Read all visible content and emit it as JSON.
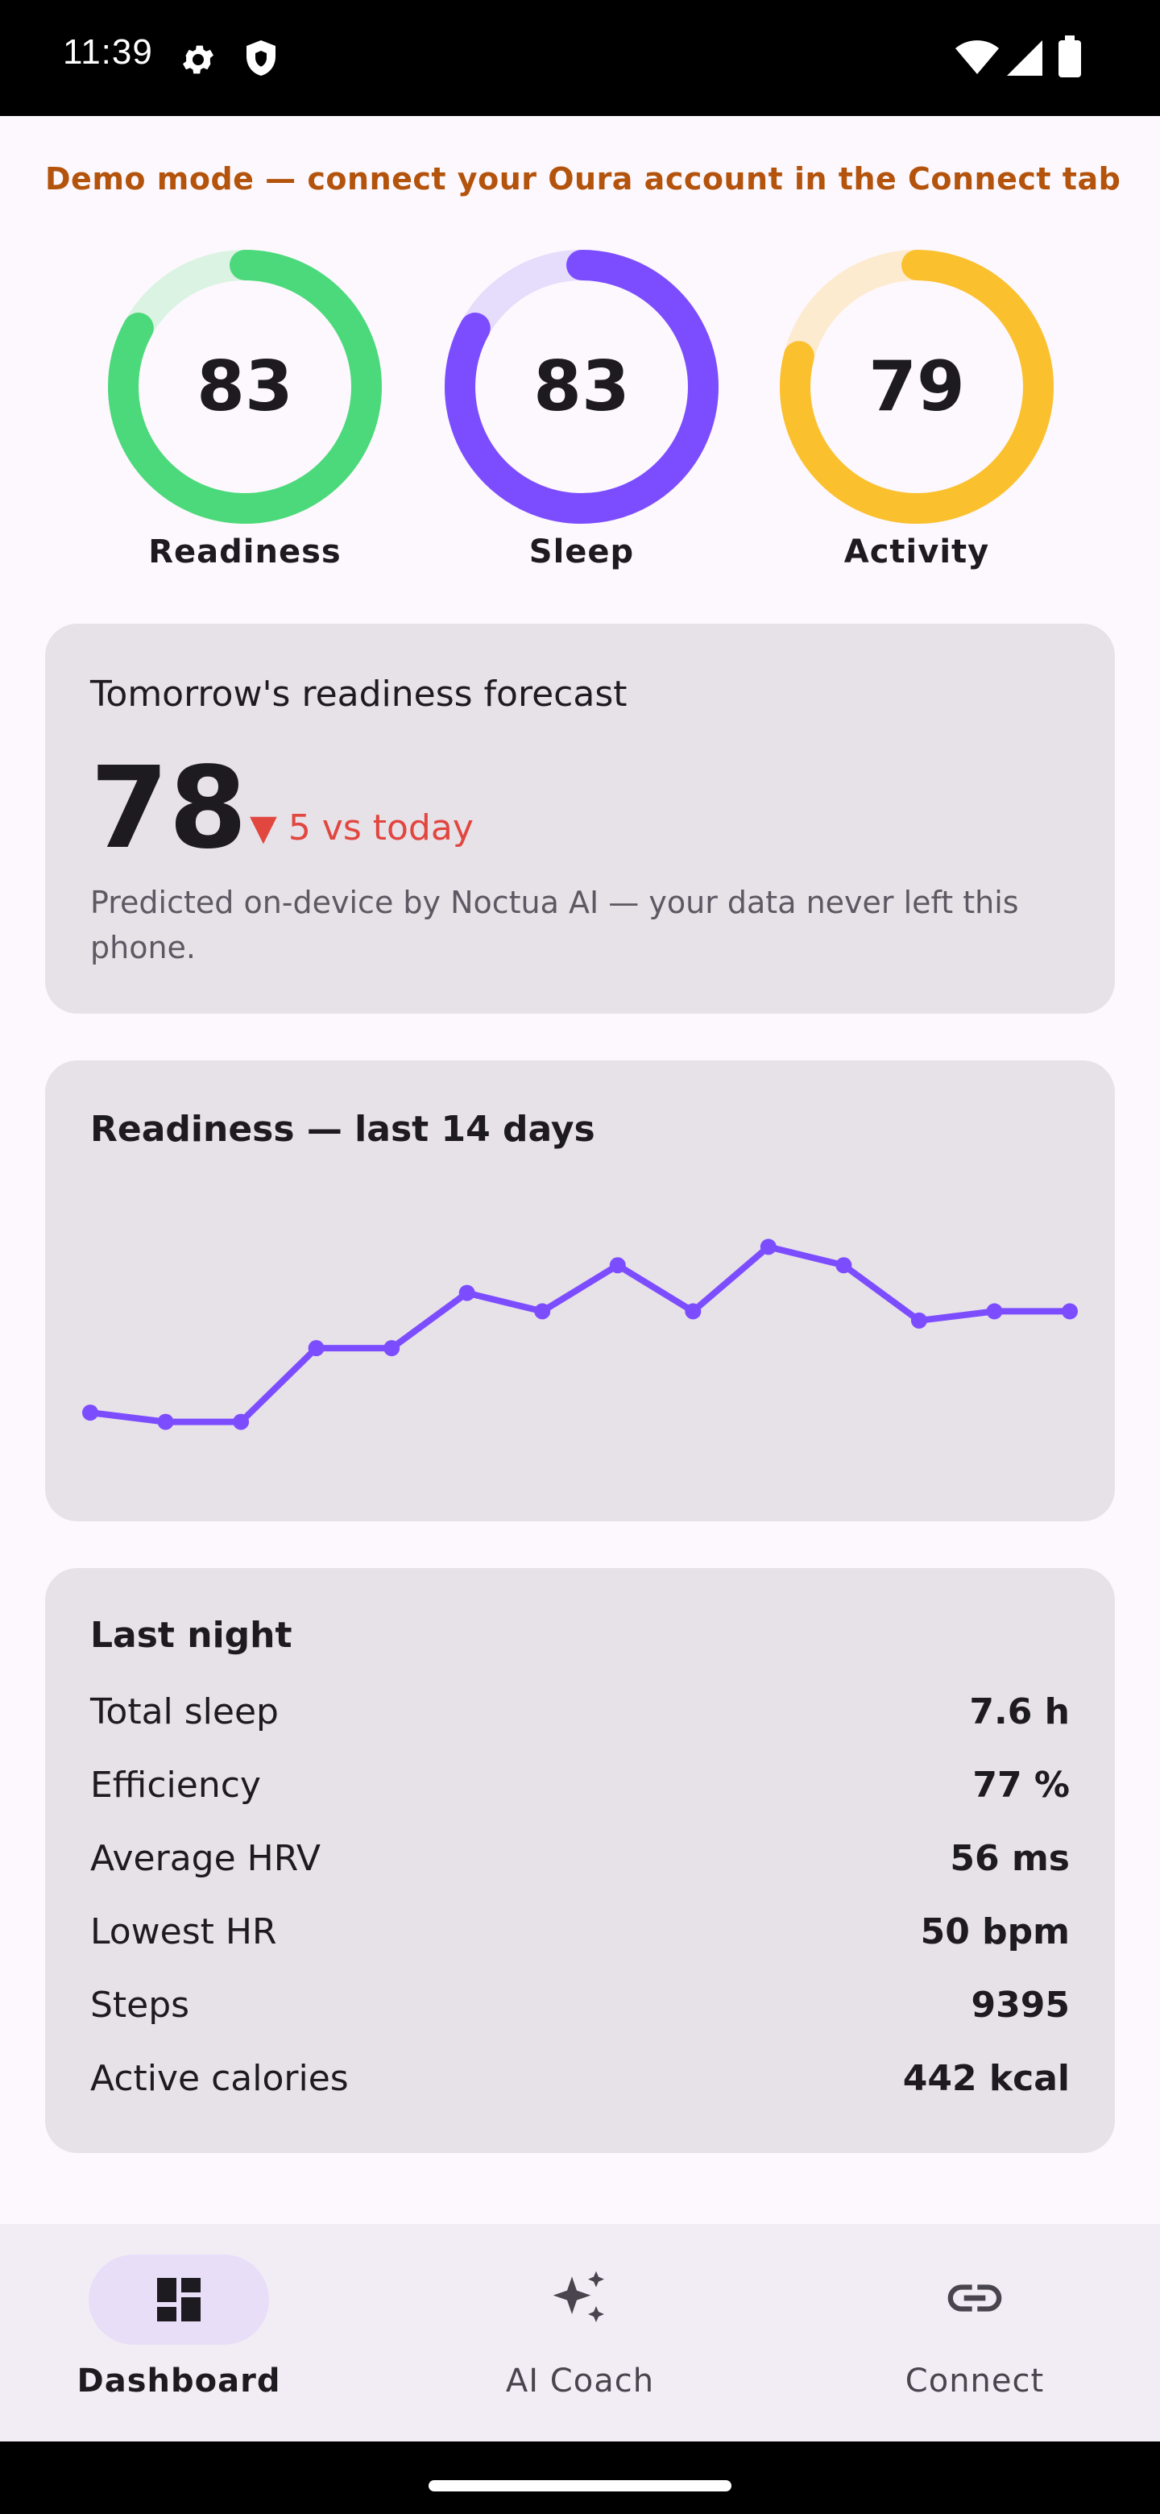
{
  "status_bar": {
    "time": "11:39",
    "icons_left": [
      "gear-icon",
      "shield-icon"
    ],
    "icons_right": [
      "wifi-icon",
      "signal-icon",
      "battery-icon"
    ]
  },
  "banner": {
    "text": "Demo mode — connect your Oura account in the Connect tab",
    "color": "#b3530c"
  },
  "rings": [
    {
      "label": "Readiness",
      "value": "83",
      "score": 83,
      "color": "#4cd97b",
      "track": "#dbf3e2"
    },
    {
      "label": "Sleep",
      "value": "83",
      "score": 83,
      "color": "#7c4dff",
      "track": "#e6dcfb"
    },
    {
      "label": "Activity",
      "value": "79",
      "score": 79,
      "color": "#fbc02d",
      "track": "#fdebd0"
    }
  ],
  "forecast": {
    "title": "Tomorrow's readiness forecast",
    "value": "78",
    "delta": "▼ 5 vs today",
    "note": "Predicted on-device by Noctua AI — your data never left this phone."
  },
  "chart_data": {
    "type": "line",
    "title": "Readiness — last 14 days",
    "x": [
      1,
      2,
      3,
      4,
      5,
      6,
      7,
      8,
      9,
      10,
      11,
      12,
      13,
      14
    ],
    "series": [
      {
        "values": [
          69,
          68,
          68,
          76,
          76,
          82,
          80,
          85,
          80,
          87,
          85,
          79,
          80,
          80
        ]
      }
    ],
    "ylim": [
      67,
      88
    ],
    "grid": false,
    "line_color": "#7c4dff"
  },
  "last_night": {
    "title": "Last night",
    "rows": [
      {
        "label": "Total sleep",
        "value": "7.6 h"
      },
      {
        "label": "Efficiency",
        "value": "77 %"
      },
      {
        "label": "Average HRV",
        "value": "56 ms"
      },
      {
        "label": "Lowest HR",
        "value": "50 bpm"
      },
      {
        "label": "Steps",
        "value": "9395"
      },
      {
        "label": "Active calories",
        "value": "442 kcal"
      }
    ]
  },
  "nav": {
    "items": [
      {
        "label": "Dashboard",
        "icon": "dashboard-icon",
        "active": true
      },
      {
        "label": "AI Coach",
        "icon": "sparkle-icon",
        "active": false
      },
      {
        "label": "Connect",
        "icon": "link-icon",
        "active": false
      }
    ]
  }
}
